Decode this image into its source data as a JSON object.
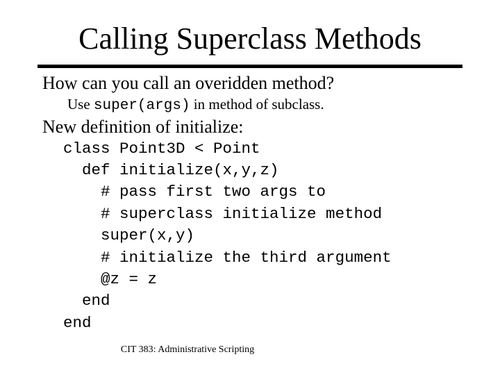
{
  "slide": {
    "title": "Calling Superclass Methods",
    "bullets": [
      {
        "text": "How can you call an overidden method?",
        "sub": {
          "prefix": "Use ",
          "code": "super(args)",
          "suffix": " in method of subclass."
        }
      },
      {
        "text": "New definition of initialize:"
      }
    ],
    "code_lines": [
      "class Point3D < Point",
      "  def initialize(x,y,z)",
      "    # pass first two args to",
      "    # superclass initialize method",
      "    super(x,y)",
      "    # initialize the third argument",
      "    @z = z",
      "  end",
      "end"
    ],
    "footer": "CIT 383: Administrative Scripting"
  }
}
